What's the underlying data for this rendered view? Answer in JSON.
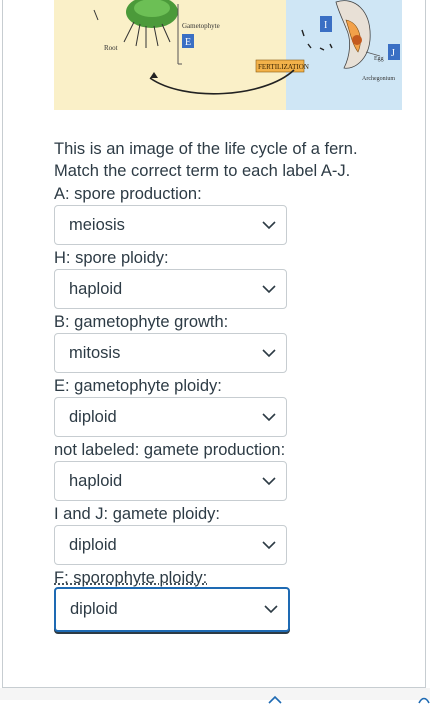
{
  "diagram": {
    "labels": {
      "root": "Root",
      "gametophyte": "Gametophyte",
      "fertilization": "FERTILIZATION",
      "egg": "Egg",
      "archegonium": "Archegonium",
      "e_tag": "E",
      "i_tag": "I",
      "j_tag": "J"
    },
    "colors": {
      "left_panel": "#faf0c8",
      "right_panel": "#cfe6f5",
      "tag": "#3a6fc4"
    }
  },
  "question": {
    "text": "This is an image of the life cycle of a fern. Match the correct term to each label A-J."
  },
  "items": [
    {
      "label": "A: spore production:",
      "answer": "meiosis"
    },
    {
      "label": "H: spore ploidy:",
      "answer": "haploid"
    },
    {
      "label": "B: gametophyte growth:",
      "answer": "mitosis"
    },
    {
      "label": "E: gametophyte ploidy:",
      "answer": "diploid"
    },
    {
      "label": "not labeled: gamete production:",
      "answer": "haploid"
    },
    {
      "label": "I and J: gamete ploidy:",
      "answer": "diploid"
    },
    {
      "label": "F: sporophyte ploidy:",
      "answer": "diploid"
    }
  ],
  "colors": {
    "text": "#2d3b45",
    "border": "#c7cdd1",
    "focus": "#1e6ab3"
  }
}
